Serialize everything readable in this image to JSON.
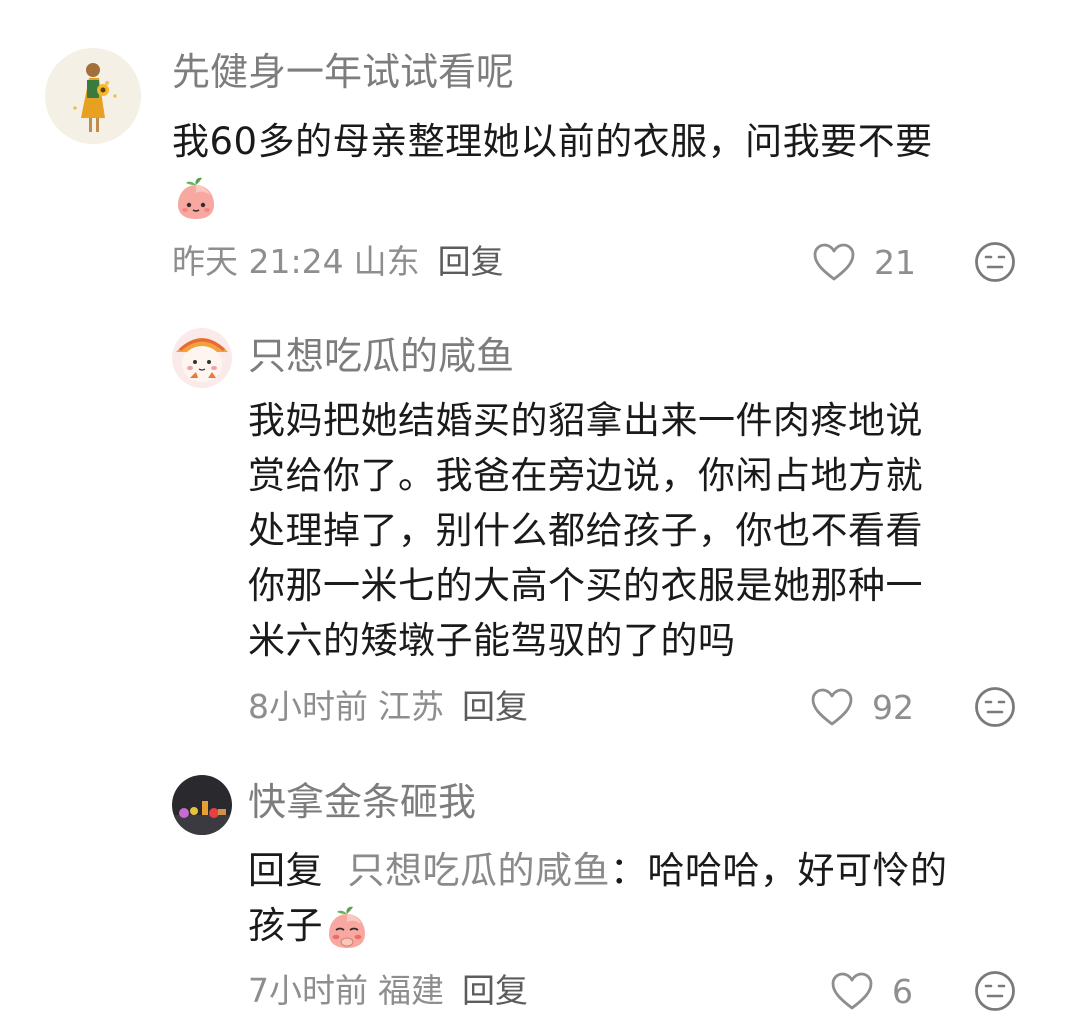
{
  "comments": [
    {
      "username": "先健身一年试试看呢",
      "lines": [
        "我60多的母亲整理她以前的衣服，问我要不要"
      ],
      "emoji": "peach-face",
      "time": "昨天 21:24",
      "location": "山东",
      "reply_label": "回复",
      "likes": "21"
    },
    {
      "username": "只想吃瓜的咸鱼",
      "lines": [
        "我妈把她结婚买的貂拿出来一件肉疼地说",
        "赏给你了。我爸在旁边说，你闲占地方就",
        "处理掉了，别什么都给孩子，你也不看看",
        "你那一米七的大高个买的衣服是她那种一",
        "米六的矮墩子能驾驭的了的吗"
      ],
      "time": "8小时前",
      "location": "江苏",
      "reply_label": "回复",
      "likes": "92"
    },
    {
      "username": "快拿金条砸我",
      "reply_prefix": "回复",
      "reply_to": "只想吃瓜的咸鱼",
      "reply_colon": "：",
      "line1_rest": "哈哈哈，好可怜的",
      "line2": "孩子",
      "emoji": "peach-shy",
      "time": "7小时前",
      "location": "福建",
      "reply_label": "回复",
      "likes": "6"
    }
  ],
  "icons": {
    "like": "heart-outline-icon",
    "dislike": "meh-face-icon"
  },
  "colors": {
    "text_primary": "#1a1a1a",
    "text_secondary": "#8e8e8e",
    "username": "#7d7d7d"
  }
}
